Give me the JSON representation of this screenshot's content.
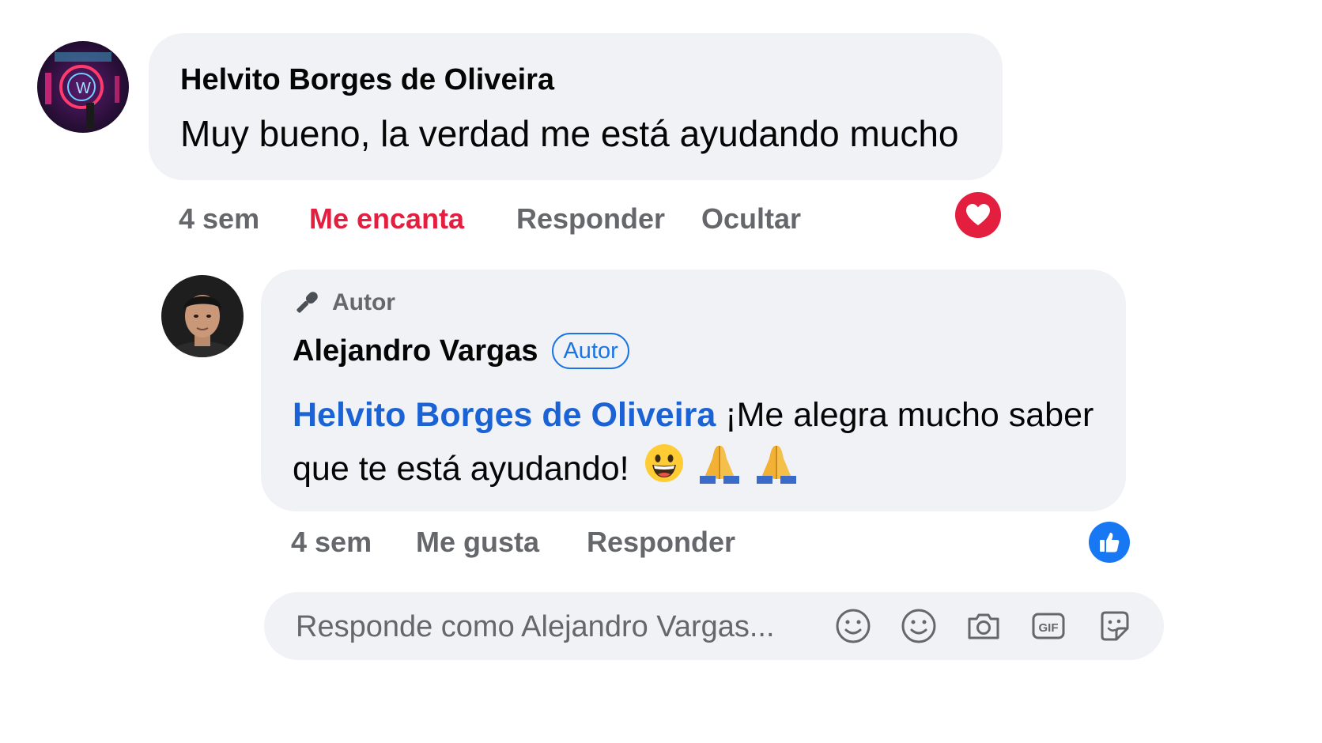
{
  "comment": {
    "author": "Helvito Borges de Oliveira",
    "text": "Muy bueno, la verdad me está ayudando mucho",
    "time": "4 sem",
    "reaction_label": "Me encanta",
    "reply_label": "Responder",
    "hide_label": "Ocultar",
    "reaction_icon": "heart-icon",
    "colors": {
      "reaction": "#e41e3f"
    }
  },
  "reply": {
    "role_tag": "Autor",
    "author": "Alejandro Vargas",
    "author_badge": "Autor",
    "mention": "Helvito Borges de Oliveira",
    "text": "¡Me alegra mucho saber que te está ayudando!",
    "emojis": [
      "grinning-face",
      "folded-hands",
      "folded-hands"
    ],
    "time": "4 sem",
    "like_label": "Me gusta",
    "reply_label": "Responder",
    "reaction_icon": "thumbs-up-icon",
    "colors": {
      "mention": "#1b63d4",
      "like_badge": "#1877f2"
    }
  },
  "composer": {
    "placeholder": "Responde como Alejandro Vargas...",
    "tools": [
      "smile-icon",
      "smile-icon",
      "camera-icon",
      "gif-icon",
      "sticker-icon"
    ]
  }
}
